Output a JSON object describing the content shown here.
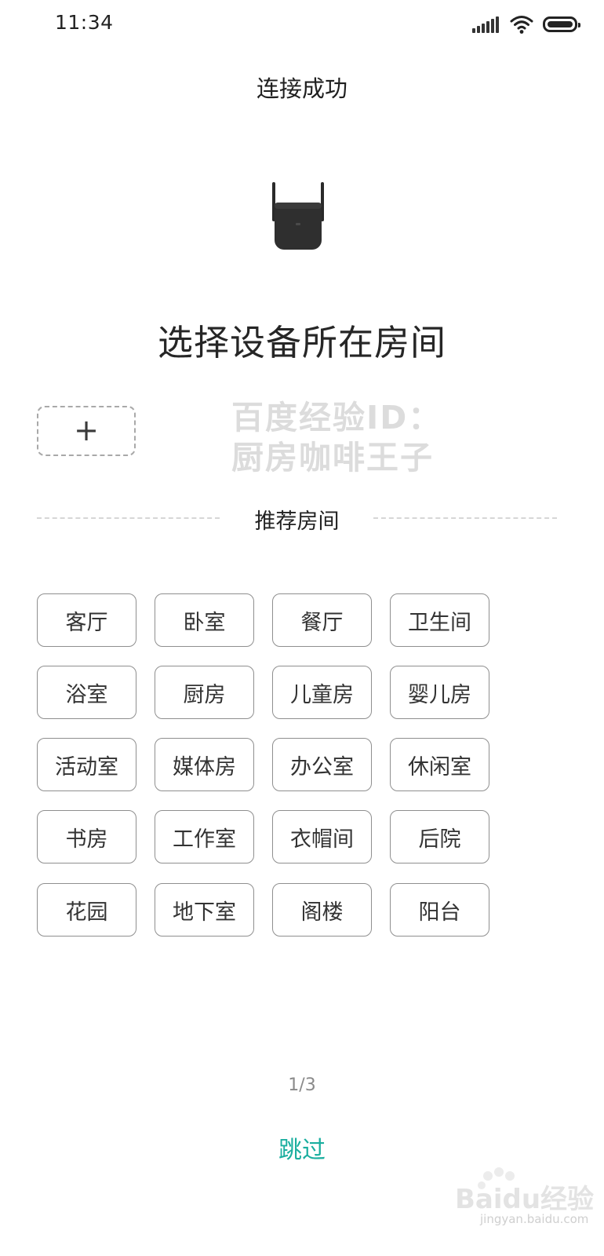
{
  "status_bar": {
    "time": "11:34"
  },
  "header": {
    "title": "连接成功"
  },
  "device": {
    "icon": "range-extender-device-icon"
  },
  "main": {
    "title": "选择设备所在房间"
  },
  "add_room": {
    "icon": "+"
  },
  "watermark": {
    "line1": "百度经验ID：",
    "line2": "厨房咖啡王子"
  },
  "recommended": {
    "label": "推荐房间",
    "rooms": [
      "客厅",
      "卧室",
      "餐厅",
      "卫生间",
      "浴室",
      "厨房",
      "儿童房",
      "婴儿房",
      "活动室",
      "媒体房",
      "办公室",
      "休闲室",
      "书房",
      "工作室",
      "衣帽间",
      "后院",
      "花园",
      "地下室",
      "阁楼",
      "阳台"
    ]
  },
  "pager": {
    "text": "1/3"
  },
  "skip": {
    "label": "跳过"
  },
  "brand_watermark": {
    "text": "Baidu经验",
    "sub": "jingyan.baidu.com"
  },
  "colors": {
    "accent": "#1aae9f",
    "chip_border": "#8f8f8f",
    "dashed": "#a9a9a9"
  }
}
